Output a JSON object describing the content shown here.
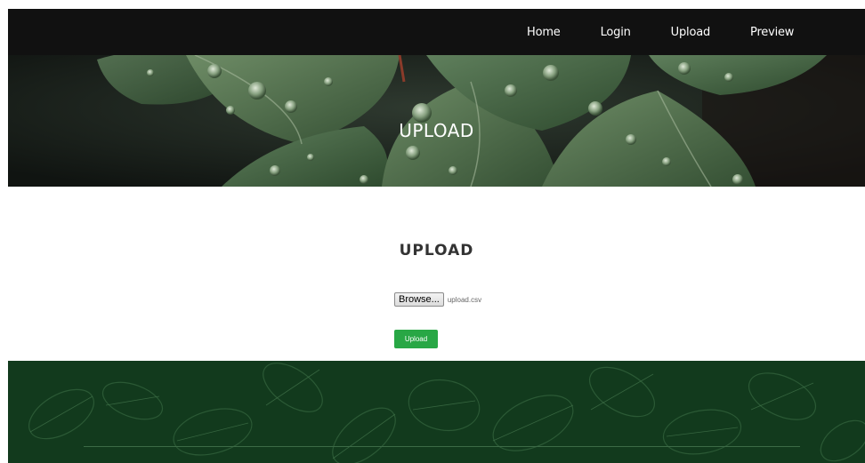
{
  "nav": {
    "items": [
      {
        "label": "Home"
      },
      {
        "label": "Login"
      },
      {
        "label": "Upload"
      },
      {
        "label": "Preview"
      }
    ]
  },
  "hero": {
    "title": "UPLOAD"
  },
  "main": {
    "heading": "UPLOAD",
    "file_input": {
      "button_label": "Browse...",
      "selected_file": "upload.csv"
    },
    "upload_button": "Upload"
  },
  "colors": {
    "navbar": "#111111",
    "upload_button": "#28a745",
    "footer": "#123a1d"
  }
}
